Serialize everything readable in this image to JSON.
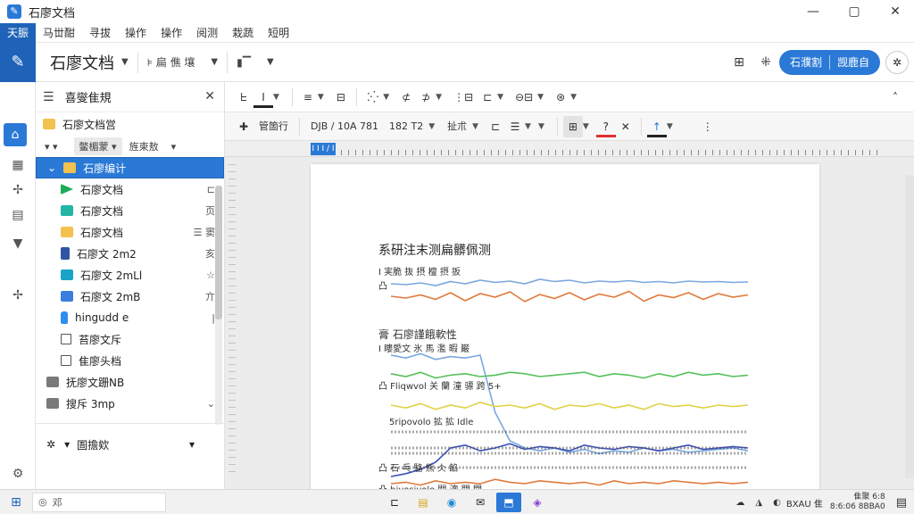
{
  "window": {
    "title": "石廖文档",
    "minimize": "—",
    "maximize": "▢",
    "close": "✕"
  },
  "menu": [
    "天脤",
    "马丗酣",
    "寻拔",
    "操作",
    "操作",
    "阅测",
    "栽蔬",
    "短明"
  ],
  "toolbar": {
    "brand_icon": "✎",
    "doc_title": "石廖文档",
    "group1": "⊧ 扁 僬 壤",
    "pill_left": "石濮割",
    "pill_right": "觊鹿自",
    "icon1": "⊞",
    "icon2": "⁜",
    "user_icon": "✲"
  },
  "rail": [
    "⌂",
    "▦",
    "✢",
    "▤",
    "▼",
    "✢",
    "⚙"
  ],
  "sidebar": {
    "title": "喜燮隹規",
    "root": "石廖文档営",
    "filter1": "鳖楣蒙",
    "filter2": "旌柬敖",
    "items": [
      {
        "label": "石廖编计",
        "trail": "",
        "icon": "folder",
        "indent": 1,
        "selected": true
      },
      {
        "label": "石廖文档",
        "trail": "⊏",
        "icon": "green",
        "indent": 2
      },
      {
        "label": "石廖文档",
        "trail": "页",
        "icon": "teal",
        "indent": 2
      },
      {
        "label": "石廖文档",
        "trail": "☰ 窦",
        "icon": "folder",
        "indent": 2
      },
      {
        "label": "石廖文 2m2",
        "trail": "亥",
        "icon": "navy",
        "indent": 2
      },
      {
        "label": "石廖文 2mLl",
        "trail": "☆",
        "icon": "cyan",
        "indent": 2
      },
      {
        "label": "石廖文 2mB",
        "trail": "亣",
        "icon": "blue",
        "indent": 2
      },
      {
        "label": "hingudd e",
        "trail": "|",
        "icon": "bottle",
        "indent": 2
      },
      {
        "label": "苔廖文斥",
        "trail": "",
        "icon": "check",
        "indent": 2
      },
      {
        "label": "隹廖头档",
        "trail": "",
        "icon": "check",
        "indent": 2
      },
      {
        "label": "抚廖文跚NB",
        "trail": "",
        "icon": "gray",
        "indent": 1
      },
      {
        "label": "搜斥 3mp",
        "trail": "⌄",
        "icon": "gray",
        "indent": 1
      }
    ],
    "footer_label": "圄擔欸"
  },
  "format_bar1": [
    "ᖶ",
    "I",
    "≡",
    "⊟",
    "⁚⁛",
    "⊄",
    "⊅",
    "⋮⊟",
    "⊏",
    "⊖⊟",
    "⊛"
  ],
  "format_bar2": {
    "style": "管箇行",
    "font": "DJB / 10A 781",
    "size": "182 T2",
    "spacing": "扯朮",
    "para": "⊏"
  },
  "ruler": {
    "marker": "I I I / I"
  },
  "document": {
    "heading": "系研注末测扁髒佩测",
    "sec1_sub": "I 実脆 抜 摂 檀 摂 扳",
    "sec1_item": "凸",
    "sec2_title": "膏 石廖謹餓軟性",
    "sec2_sub": "I 瞜愛文 氷 馬 濫 暇 巌",
    "sec2_item1": "凸 Fliqwvol 关 蘭 潼 骠 跨 5+",
    "sec2_item2": "5ripovolo 拡 拡 Idle",
    "sec2_item3": "凸 石 乓 駱 熊 仌 餡",
    "sec2_item4": "凸 hivosivolo 關 漗 関 関"
  },
  "chart_data": [
    {
      "type": "line",
      "series": [
        {
          "color": "#e07a3c",
          "values": [
            0.52,
            0.48,
            0.55,
            0.45,
            0.6,
            0.42,
            0.58,
            0.5,
            0.62,
            0.4,
            0.56,
            0.47,
            0.6,
            0.44,
            0.57,
            0.5,
            0.63,
            0.41,
            0.55,
            0.49,
            0.6,
            0.45,
            0.58,
            0.5,
            0.55
          ]
        },
        {
          "color": "#7aa8e0",
          "values": [
            0.8,
            0.78,
            0.82,
            0.76,
            0.85,
            0.8,
            0.88,
            0.83,
            0.86,
            0.8,
            0.9,
            0.85,
            0.88,
            0.82,
            0.86,
            0.84,
            0.87,
            0.83,
            0.85,
            0.82,
            0.86,
            0.84,
            0.85,
            0.83,
            0.84
          ]
        }
      ]
    },
    {
      "type": "line",
      "series": [
        {
          "color": "#7aa8e0",
          "values": [
            0.95,
            0.93,
            0.96,
            0.92,
            0.94,
            0.93,
            0.95,
            0.55,
            0.35,
            0.3,
            0.28,
            0.3,
            0.27,
            0.29,
            0.26,
            0.28,
            0.27,
            0.3,
            0.28,
            0.29,
            0.27,
            0.28,
            0.29,
            0.3,
            0.28
          ]
        },
        {
          "color": "#56c05a",
          "values": [
            0.82,
            0.8,
            0.83,
            0.79,
            0.81,
            0.82,
            0.8,
            0.81,
            0.83,
            0.82,
            0.8,
            0.81,
            0.82,
            0.83,
            0.8,
            0.82,
            0.81,
            0.79,
            0.82,
            0.8,
            0.83,
            0.81,
            0.82,
            0.8,
            0.81
          ]
        },
        {
          "color": "#e2d046",
          "values": [
            0.6,
            0.58,
            0.61,
            0.57,
            0.6,
            0.58,
            0.62,
            0.59,
            0.6,
            0.58,
            0.61,
            0.57,
            0.6,
            0.59,
            0.61,
            0.58,
            0.6,
            0.57,
            0.61,
            0.59,
            0.6,
            0.58,
            0.6,
            0.59,
            0.6
          ]
        },
        {
          "color": "#3b4fb8",
          "values": [
            0.1,
            0.12,
            0.15,
            0.2,
            0.3,
            0.32,
            0.28,
            0.3,
            0.33,
            0.29,
            0.31,
            0.3,
            0.28,
            0.32,
            0.3,
            0.29,
            0.31,
            0.3,
            0.28,
            0.3,
            0.32,
            0.29,
            0.3,
            0.31,
            0.3
          ]
        },
        {
          "color": "#e07a3c",
          "values": [
            0.05,
            0.06,
            0.04,
            0.07,
            0.05,
            0.06,
            0.05,
            0.08,
            0.06,
            0.05,
            0.07,
            0.06,
            0.05,
            0.06,
            0.04,
            0.07,
            0.05,
            0.06,
            0.05,
            0.07,
            0.06,
            0.05,
            0.06,
            0.05,
            0.06
          ]
        }
      ]
    }
  ],
  "taskbar": {
    "start": "⊞",
    "search": "邓",
    "apps": [
      "⊏",
      "▤",
      "◉",
      "✉",
      "⬒",
      "◈"
    ],
    "tray_label": "BXAU 隹",
    "clock_line1": "隹聚 6:8",
    "clock_line2": "8:6:06 8BBA0"
  }
}
